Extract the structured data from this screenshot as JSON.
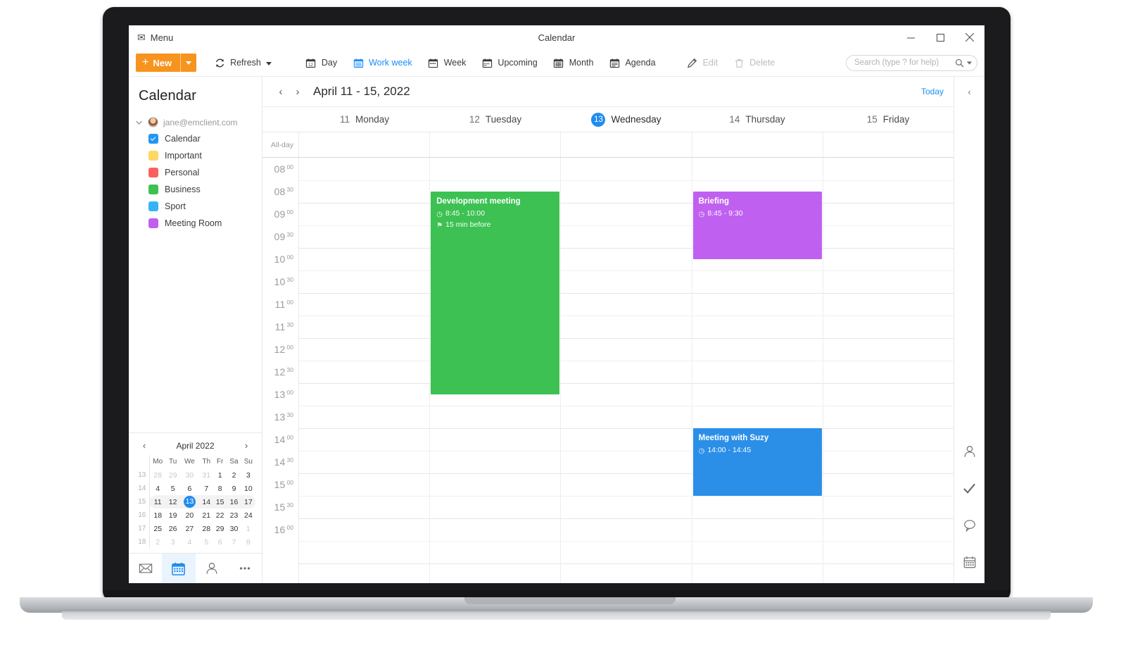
{
  "window": {
    "menu_label": "Menu",
    "title": "Calendar",
    "minimize": "minimize",
    "maximize": "maximize",
    "close": "close"
  },
  "toolbar": {
    "new_label": "New",
    "new_caret": "chevron-down",
    "refresh_label": "Refresh",
    "refresh_caret": "chevron-down",
    "views": [
      {
        "label": "Day",
        "icon": "calendar-day-icon",
        "active": false
      },
      {
        "label": "Work week",
        "icon": "calendar-workweek-icon",
        "active": true
      },
      {
        "label": "Week",
        "icon": "calendar-week-icon",
        "active": false
      },
      {
        "label": "Upcoming",
        "icon": "calendar-upcoming-icon",
        "active": false
      },
      {
        "label": "Month",
        "icon": "calendar-month-icon",
        "active": false
      },
      {
        "label": "Agenda",
        "icon": "calendar-agenda-icon",
        "active": false
      }
    ],
    "edit_label": "Edit",
    "delete_label": "Delete",
    "search_placeholder": "Search (type ? for help)"
  },
  "sidebar": {
    "title": "Calendar",
    "account": "jane@emclient.com",
    "calendars": [
      {
        "label": "Calendar",
        "color": "#2196f3",
        "checked": true
      },
      {
        "label": "Important",
        "color": "#ffd champagne",
        "checked": false
      },
      {
        "label": "Personal",
        "color": "#f9615c",
        "checked": false
      },
      {
        "label": "Business",
        "color": "#3cc152",
        "checked": false
      },
      {
        "label": "Sport",
        "color": "#35b4f5",
        "checked": false
      },
      {
        "label": "Meeting Room",
        "color": "#c060f0",
        "checked": false
      }
    ],
    "calendar_colors": [
      "#2196f3",
      "#ffd764",
      "#f9615c",
      "#3cc152",
      "#35b4f5",
      "#c060f0"
    ],
    "bottom_nav": [
      {
        "name": "mail",
        "active": false
      },
      {
        "name": "calendar",
        "active": true
      },
      {
        "name": "contacts",
        "active": false
      },
      {
        "name": "more",
        "active": false
      }
    ]
  },
  "mini_calendar": {
    "month_title": "April 2022",
    "prev": "‹",
    "next": "›",
    "weekday_headers": [
      "Mo",
      "Tu",
      "We",
      "Th",
      "Fr",
      "Sa",
      "Su"
    ],
    "week_numbers": [
      "13",
      "14",
      "15",
      "16",
      "17",
      "18"
    ],
    "today": 13,
    "current_week_index": 2,
    "weeks": [
      {
        "wk": "13",
        "days": [
          {
            "d": "28",
            "out": true
          },
          {
            "d": "29",
            "out": true
          },
          {
            "d": "30",
            "out": true
          },
          {
            "d": "31",
            "out": true
          },
          {
            "d": "1",
            "out": false
          },
          {
            "d": "2",
            "out": false
          },
          {
            "d": "3",
            "out": false
          }
        ]
      },
      {
        "wk": "14",
        "days": [
          {
            "d": "4",
            "out": false
          },
          {
            "d": "5",
            "out": false
          },
          {
            "d": "6",
            "out": false
          },
          {
            "d": "7",
            "out": false
          },
          {
            "d": "8",
            "out": false
          },
          {
            "d": "9",
            "out": false
          },
          {
            "d": "10",
            "out": false
          }
        ]
      },
      {
        "wk": "15",
        "days": [
          {
            "d": "11",
            "out": false
          },
          {
            "d": "12",
            "out": false
          },
          {
            "d": "13",
            "out": false,
            "today": true
          },
          {
            "d": "14",
            "out": false
          },
          {
            "d": "15",
            "out": false
          },
          {
            "d": "16",
            "out": false
          },
          {
            "d": "17",
            "out": false
          }
        ]
      },
      {
        "wk": "16",
        "days": [
          {
            "d": "18",
            "out": false
          },
          {
            "d": "19",
            "out": false
          },
          {
            "d": "20",
            "out": false
          },
          {
            "d": "21",
            "out": false
          },
          {
            "d": "22",
            "out": false
          },
          {
            "d": "23",
            "out": false
          },
          {
            "d": "24",
            "out": false
          }
        ]
      },
      {
        "wk": "17",
        "days": [
          {
            "d": "25",
            "out": false
          },
          {
            "d": "26",
            "out": false
          },
          {
            "d": "27",
            "out": false
          },
          {
            "d": "28",
            "out": false
          },
          {
            "d": "29",
            "out": false
          },
          {
            "d": "30",
            "out": false
          },
          {
            "d": "1",
            "out": true
          }
        ]
      },
      {
        "wk": "18",
        "days": [
          {
            "d": "2",
            "out": true
          },
          {
            "d": "3",
            "out": true
          },
          {
            "d": "4",
            "out": true
          },
          {
            "d": "5",
            "out": true
          },
          {
            "d": "6",
            "out": true
          },
          {
            "d": "7",
            "out": true
          },
          {
            "d": "8",
            "out": true
          }
        ]
      }
    ]
  },
  "calendar_view": {
    "prev_arrow": "‹",
    "next_arrow": "›",
    "range_title": "April 11 - 15, 2022",
    "today_label": "Today",
    "allday_label": "All-day",
    "days": [
      {
        "num": "11",
        "name": "Monday",
        "today": false
      },
      {
        "num": "12",
        "name": "Tuesday",
        "today": false
      },
      {
        "num": "13",
        "name": "Wednesday",
        "today": true
      },
      {
        "num": "14",
        "name": "Thursday",
        "today": false
      },
      {
        "num": "15",
        "name": "Friday",
        "today": false
      }
    ],
    "time_slots": [
      {
        "hh": "08",
        "mm": "00"
      },
      {
        "hh": "08",
        "mm": "30"
      },
      {
        "hh": "09",
        "mm": "00"
      },
      {
        "hh": "09",
        "mm": "30"
      },
      {
        "hh": "10",
        "mm": "00"
      },
      {
        "hh": "10",
        "mm": "30"
      },
      {
        "hh": "11",
        "mm": "00"
      },
      {
        "hh": "11",
        "mm": "30"
      },
      {
        "hh": "12",
        "mm": "00"
      },
      {
        "hh": "12",
        "mm": "30"
      },
      {
        "hh": "13",
        "mm": "00"
      },
      {
        "hh": "13",
        "mm": "30"
      },
      {
        "hh": "14",
        "mm": "00"
      },
      {
        "hh": "14",
        "mm": "30"
      },
      {
        "hh": "15",
        "mm": "00"
      },
      {
        "hh": "15",
        "mm": "30"
      },
      {
        "hh": "16",
        "mm": "00"
      }
    ],
    "events": [
      {
        "title": "Development meeting",
        "time": "8:45 - 10:00",
        "reminder": "15 min before",
        "color": "#3cc152",
        "day_index": 1,
        "start_minutes": 525,
        "end_minutes": 795
      },
      {
        "title": "Briefing",
        "time": "8:45 - 9:30",
        "reminder": null,
        "color": "#c060f0",
        "day_index": 3,
        "start_minutes": 525,
        "end_minutes": 615
      },
      {
        "title": "Meeting with Suzy",
        "time": "14:00 - 14:45",
        "reminder": null,
        "color": "#2b8fe8",
        "day_index": 3,
        "start_minutes": 840,
        "end_minutes": 930
      }
    ]
  },
  "right_rail": {
    "collapse": "‹",
    "items": [
      "contacts-icon",
      "tasks-icon",
      "chat-icon",
      "calendar-icon"
    ]
  }
}
